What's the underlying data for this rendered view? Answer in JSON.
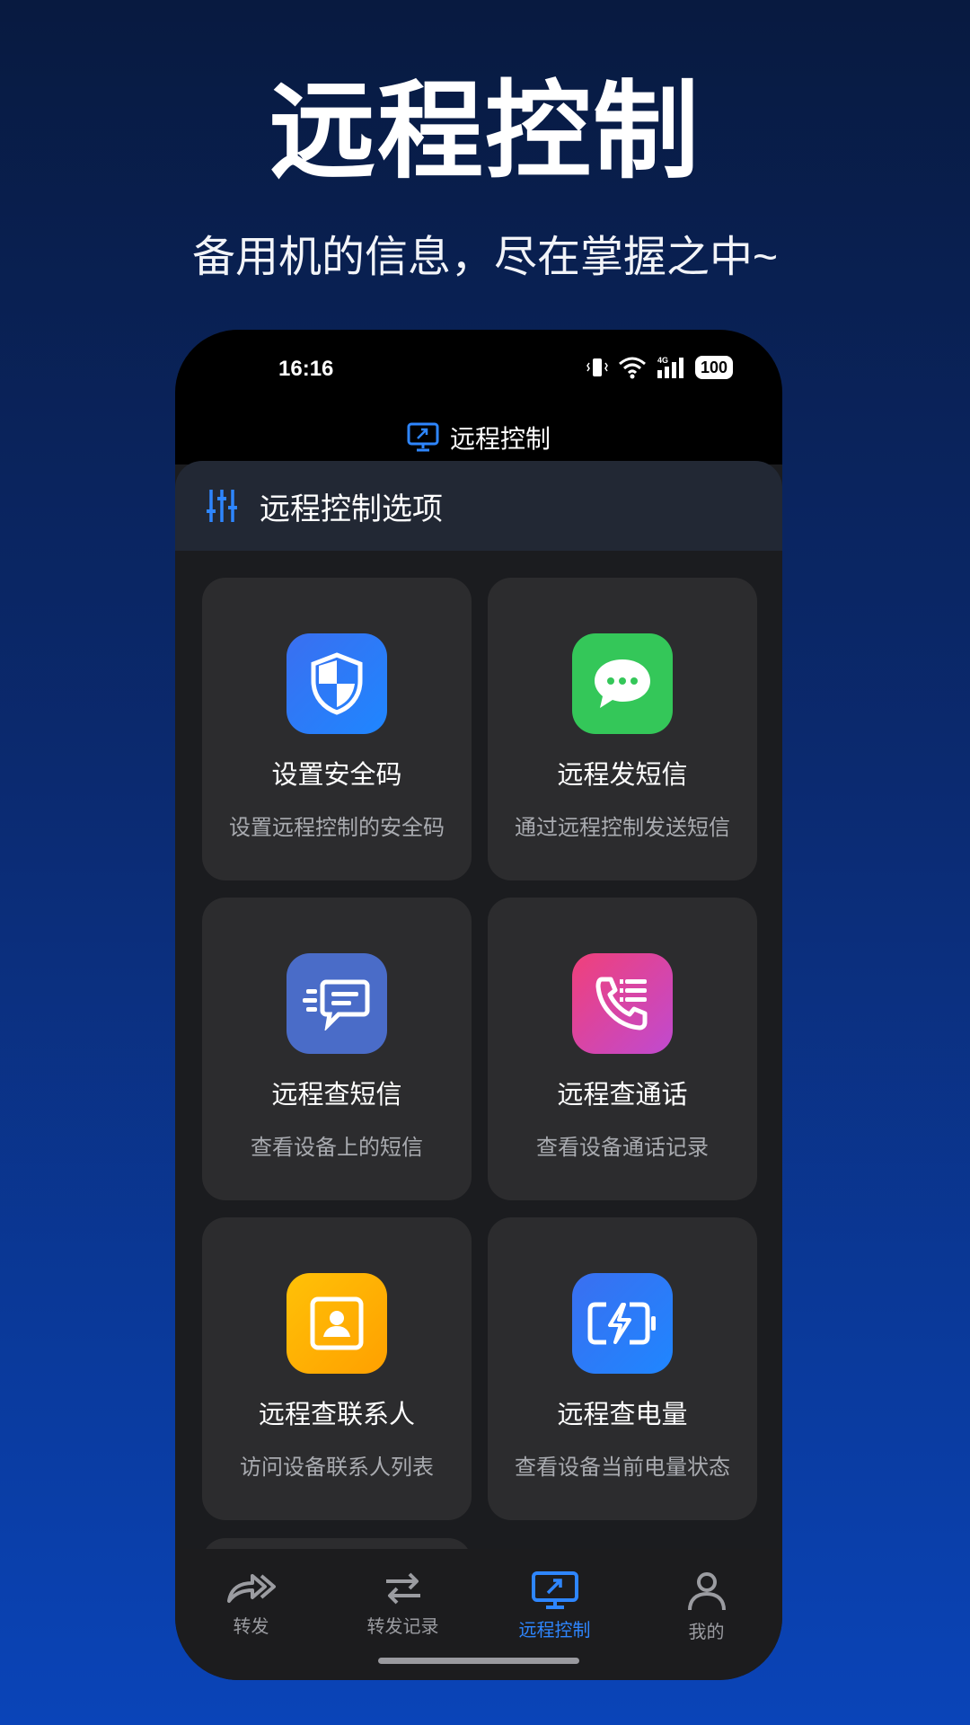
{
  "hero": {
    "title": "远程控制",
    "subtitle": "备用机的信息，尽在掌握之中~"
  },
  "status_bar": {
    "time": "16:16",
    "network": "4G",
    "battery": "100"
  },
  "app_bar": {
    "title": "远程控制",
    "icon": "remote-monitor-icon"
  },
  "section": {
    "title": "远程控制选项",
    "icon": "sliders-icon"
  },
  "cards": [
    {
      "title": "设置安全码",
      "desc": "设置远程控制的安全码",
      "icon": "shield-icon",
      "color": "#2f7bf6"
    },
    {
      "title": "远程发短信",
      "desc": "通过远程控制发送短信",
      "icon": "message-bubble-icon",
      "color": "#34c759"
    },
    {
      "title": "远程查短信",
      "desc": "查看设备上的短信",
      "icon": "message-list-icon",
      "color": "#4a6cc8"
    },
    {
      "title": "远程查通话",
      "desc": "查看设备通话记录",
      "icon": "phone-log-icon",
      "color": "#e0407a"
    },
    {
      "title": "远程查联系人",
      "desc": "访问设备联系人列表",
      "icon": "contact-card-icon",
      "color": "#ffb300"
    },
    {
      "title": "远程查电量",
      "desc": "查看设备当前电量状态",
      "icon": "battery-charge-icon",
      "color": "#2a7af5"
    }
  ],
  "tab_bar": {
    "tabs": [
      {
        "label": "转发",
        "icon": "forward-arrow-icon",
        "active": false
      },
      {
        "label": "转发记录",
        "icon": "swap-arrows-icon",
        "active": false
      },
      {
        "label": "远程控制",
        "icon": "remote-monitor-icon",
        "active": true
      },
      {
        "label": "我的",
        "icon": "person-icon",
        "active": false
      }
    ],
    "active_color": "#2e86ff"
  }
}
